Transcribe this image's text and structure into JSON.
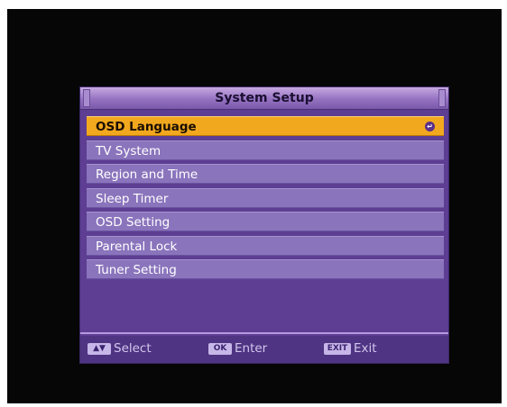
{
  "window": {
    "title": "System Setup"
  },
  "menu": {
    "items": [
      {
        "label": "OSD Language",
        "selected": true
      },
      {
        "label": "TV System",
        "selected": false
      },
      {
        "label": "Region and Time",
        "selected": false
      },
      {
        "label": "Sleep Timer",
        "selected": false
      },
      {
        "label": "OSD Setting",
        "selected": false
      },
      {
        "label": "Parental Lock",
        "selected": false
      },
      {
        "label": "Tuner Setting",
        "selected": false
      }
    ],
    "selected_indicator_icon": "enter-arrow-icon"
  },
  "footer": {
    "select": {
      "key": "▲▼",
      "label": "Select",
      "icon": "up-down-arrows-icon"
    },
    "enter": {
      "key": "OK",
      "label": "Enter",
      "icon": "ok-key-icon"
    },
    "exit": {
      "key": "EXIT",
      "label": "Exit",
      "icon": "exit-key-icon"
    }
  },
  "colors": {
    "panel": "#5d3e93",
    "item": "#8a74bc",
    "selected": "#f2a81e",
    "titlebar": "#9572c1",
    "screen": "#060606"
  }
}
